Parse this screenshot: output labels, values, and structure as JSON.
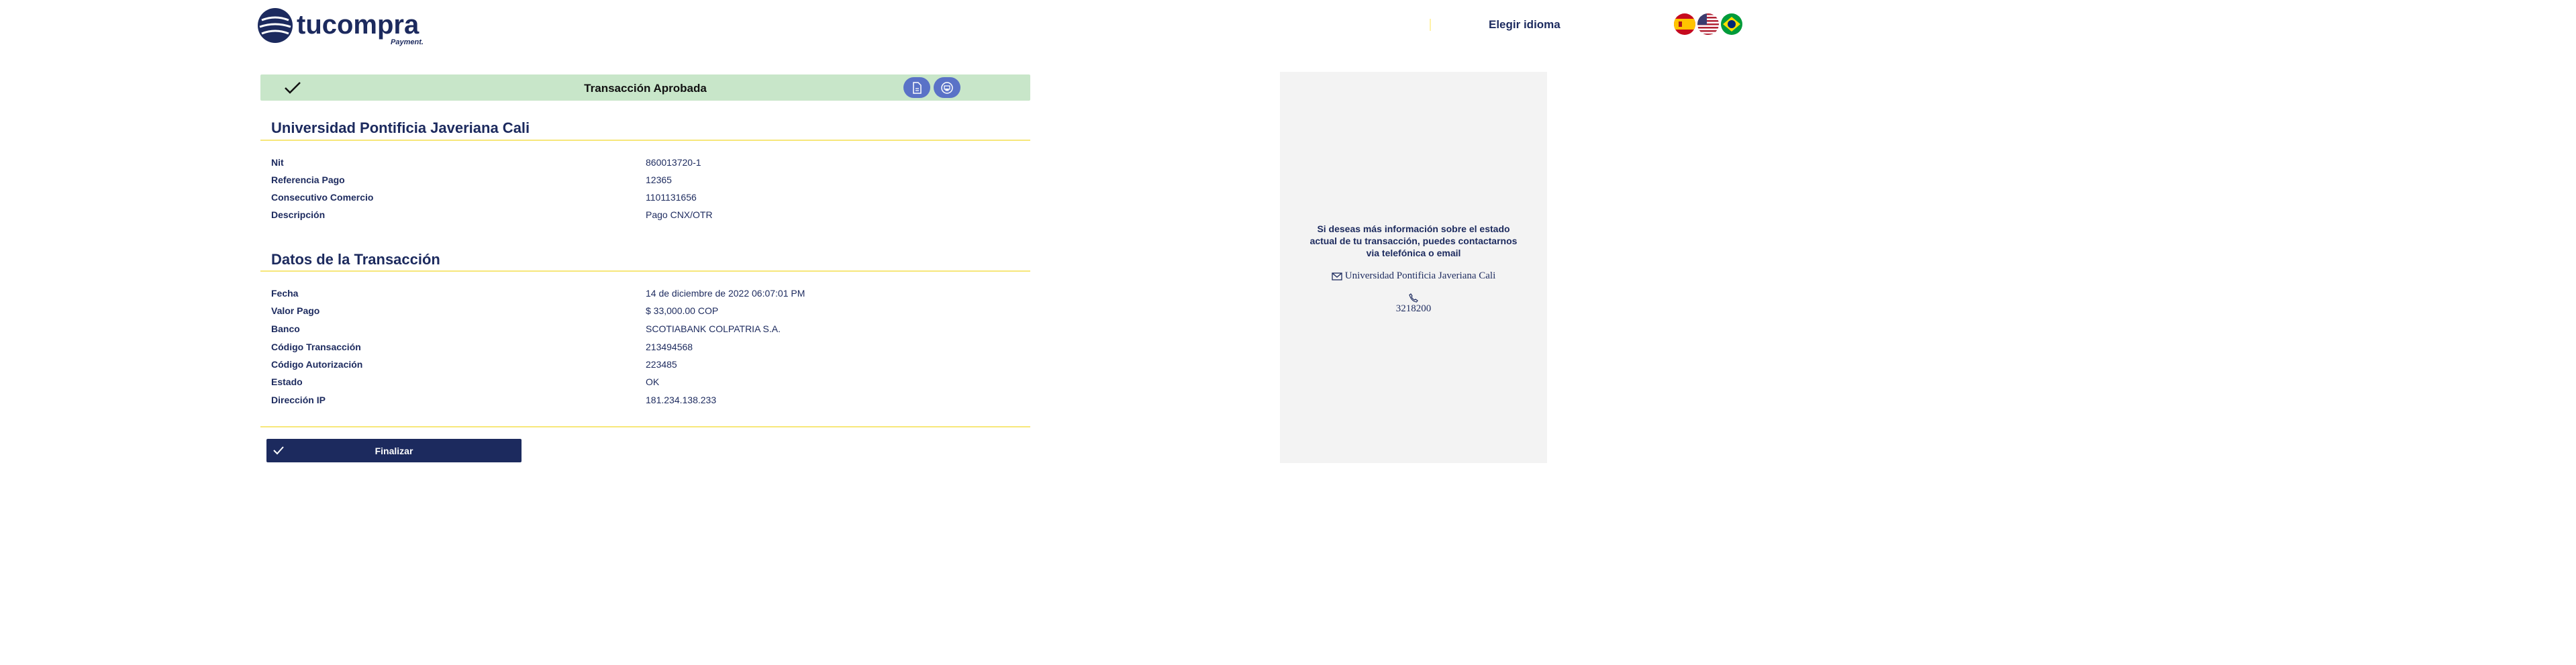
{
  "brand": {
    "logo_text": "tucompra",
    "logo_subtext": "Payment."
  },
  "language": {
    "label": "Elegir idioma",
    "flags": [
      "spain-flag-icon",
      "usa-flag-icon",
      "brazil-flag-icon"
    ]
  },
  "status": {
    "text": "Transacción Aprobada",
    "icon": "check-icon",
    "actions": [
      "pdf-icon",
      "print-icon"
    ]
  },
  "merchant": {
    "title": "Universidad Pontificia Javeriana Cali",
    "rows": [
      {
        "label": "Nit",
        "value": "860013720-1"
      },
      {
        "label": "Referencia Pago",
        "value": "12365"
      },
      {
        "label": "Consecutivo Comercio",
        "value": "1101131656"
      },
      {
        "label": "Descripción",
        "value": "Pago CNX/OTR"
      }
    ]
  },
  "transaction": {
    "title": "Datos de la Transacción",
    "rows": [
      {
        "label": "Fecha",
        "value": "14 de diciembre de 2022 06:07:01 PM"
      },
      {
        "label": "Valor Pago",
        "value": "$ 33,000.00 COP"
      },
      {
        "label": "Banco",
        "value": "SCOTIABANK COLPATRIA S.A."
      },
      {
        "label": "Código Transacción",
        "value": "213494568"
      },
      {
        "label": "Código Autorización",
        "value": "223485"
      },
      {
        "label": "Estado",
        "value": "OK"
      },
      {
        "label": "Dirección IP",
        "value": "181.234.138.233"
      }
    ]
  },
  "finish": {
    "label": "Finalizar"
  },
  "contact": {
    "text": "Si deseas más información sobre el estado actual de tu transacción, puedes contactarnos via telefónica o email",
    "company": "Universidad Pontificia Javeriana Cali",
    "phone": "3218200"
  },
  "colors": {
    "primary": "#1c2a5e",
    "success_bg": "#c8e6c9",
    "accent_line": "#f7e77a",
    "action_btn": "#5a72c7",
    "panel_bg": "#f3f3f3"
  }
}
